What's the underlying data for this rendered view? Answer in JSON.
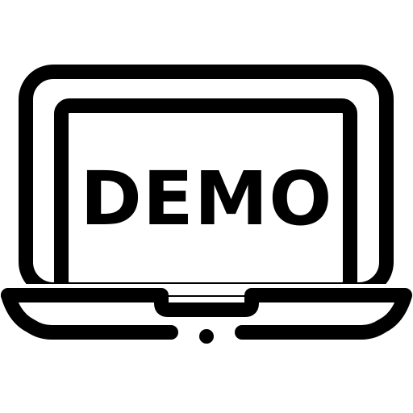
{
  "icon": {
    "name": "laptop-demo-icon",
    "screen_text": "DEMO",
    "stroke_color": "#000000",
    "background_color": "#ffffff"
  }
}
